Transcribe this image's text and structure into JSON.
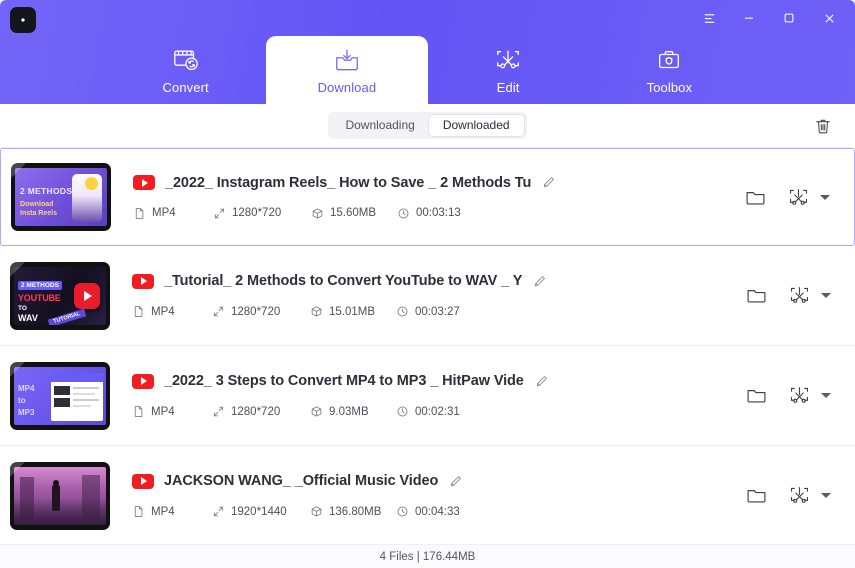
{
  "window": {
    "logo_icon": "hitpaw-logo-icon",
    "controls": [
      {
        "name": "menu-button",
        "icon": "hamburger-icon"
      },
      {
        "name": "minimize-button",
        "icon": "minimize-icon"
      },
      {
        "name": "maximize-button",
        "icon": "maximize-icon"
      },
      {
        "name": "close-button",
        "icon": "close-icon"
      }
    ],
    "accent_color": "#6a5bf5"
  },
  "tabs": [
    {
      "label": "Convert",
      "icon": "convert-icon",
      "active": false
    },
    {
      "label": "Download",
      "icon": "download-icon",
      "active": true
    },
    {
      "label": "Edit",
      "icon": "edit-icon",
      "active": false
    },
    {
      "label": "Toolbox",
      "icon": "toolbox-icon",
      "active": false
    }
  ],
  "subbar": {
    "segments": [
      {
        "label": "Downloading",
        "active": false
      },
      {
        "label": "Downloaded",
        "active": true
      }
    ],
    "delete_icon": "trash-icon"
  },
  "list": {
    "rows": [
      {
        "selected": true,
        "source_badge": "youtube-icon",
        "title": "_2022_ Instagram Reels_ How to Save _ 2 Methods Tu",
        "edit_icon": "pencil-icon",
        "format": "MP4",
        "resolution": "1280*720",
        "size": "15.60MB",
        "duration": "00:03:13",
        "thumb": {
          "bg": "#6f4fd8",
          "line1": "2 METHODS",
          "line2": "Download",
          "line3": "Insta Reels",
          "style": "reels"
        },
        "actions": [
          {
            "name": "open-folder-button",
            "icon": "folder-icon"
          },
          {
            "name": "edit-video-button",
            "icon": "scissors-edit-icon"
          },
          {
            "name": "more-options-button",
            "icon": "chevron-down-icon"
          }
        ]
      },
      {
        "selected": false,
        "source_badge": "youtube-icon",
        "title": "_Tutorial_ 2 Methods to Convert YouTube to WAV _ Y",
        "edit_icon": "pencil-icon",
        "format": "MP4",
        "resolution": "1280*720",
        "size": "15.01MB",
        "duration": "00:03:27",
        "thumb": {
          "bg": "#201830",
          "line1": "2 METHODS",
          "line2": "YOUTUBE",
          "line3": "TO",
          "line4": "WAV",
          "tag": "TUTORIAL",
          "style": "wav"
        },
        "actions": [
          {
            "name": "open-folder-button",
            "icon": "folder-icon"
          },
          {
            "name": "edit-video-button",
            "icon": "scissors-edit-icon"
          },
          {
            "name": "more-options-button",
            "icon": "chevron-down-icon"
          }
        ]
      },
      {
        "selected": false,
        "source_badge": "youtube-icon",
        "title": "_2022_ 3 Steps to Convert MP4 to MP3 _ HitPaw Vide",
        "edit_icon": "pencil-icon",
        "format": "MP4",
        "resolution": "1280*720",
        "size": "9.03MB",
        "duration": "00:02:31",
        "thumb": {
          "bg": "#6a5bf5",
          "line1": "MP4",
          "line2": "to",
          "line3": "MP3",
          "style": "mp3"
        },
        "actions": [
          {
            "name": "open-folder-button",
            "icon": "folder-icon"
          },
          {
            "name": "edit-video-button",
            "icon": "scissors-edit-icon"
          },
          {
            "name": "more-options-button",
            "icon": "chevron-down-icon"
          }
        ]
      },
      {
        "selected": false,
        "source_badge": "youtube-icon",
        "title": "JACKSON WANG_ _Official Music Video",
        "edit_icon": "pencil-icon",
        "format": "MP4",
        "resolution": "1920*1440",
        "size": "136.80MB",
        "duration": "00:04:33",
        "thumb": {
          "bg": "#8b4a8f",
          "style": "street"
        },
        "actions": [
          {
            "name": "open-folder-button",
            "icon": "folder-icon"
          },
          {
            "name": "edit-video-button",
            "icon": "scissors-edit-icon"
          },
          {
            "name": "more-options-button",
            "icon": "chevron-down-icon"
          }
        ]
      }
    ]
  },
  "footer": {
    "status": "4 Files | 176.44MB"
  }
}
